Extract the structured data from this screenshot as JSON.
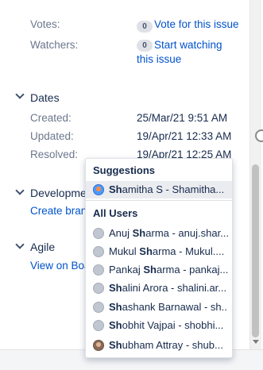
{
  "people": {
    "votes_label": "Votes:",
    "votes_count": "0",
    "votes_action": "Vote for this issue",
    "watchers_label": "Watchers:",
    "watchers_count": "0",
    "watchers_action_line1": "Start watching",
    "watchers_action_line2": "this issue"
  },
  "dates": {
    "heading": "Dates",
    "created_label": "Created:",
    "created_value": "25/Mar/21 9:51 AM",
    "updated_label": "Updated:",
    "updated_value": "19/Apr/21 12:33 AM",
    "resolved_label": "Resolved:",
    "resolved_value": "19/Apr/21 12:25 AM"
  },
  "development": {
    "heading": "Development",
    "link": "Create branch"
  },
  "agile": {
    "heading": "Agile",
    "link": "View on Board"
  },
  "suggestions": {
    "heading": "Suggestions",
    "items": [
      {
        "bold": "Sh",
        "rest": "amitha S - Shamitha...",
        "avatar": "badge"
      }
    ]
  },
  "all_users": {
    "heading": "All Users",
    "items": [
      {
        "pre": "Anuj ",
        "bold": "Sh",
        "rest": "arma - anuj.shar...",
        "avatar": "default"
      },
      {
        "pre": "Mukul ",
        "bold": "Sh",
        "rest": "arma - Mukul....",
        "avatar": "default"
      },
      {
        "pre": "Pankaj ",
        "bold": "Sh",
        "rest": "arma - pankaj....",
        "avatar": "default"
      },
      {
        "pre": "",
        "bold": "Sh",
        "rest": "alini Arora - shalini.ar...",
        "avatar": "default"
      },
      {
        "pre": "",
        "bold": "Sh",
        "rest": "ashank Barnawal - sh...",
        "avatar": "default"
      },
      {
        "pre": "",
        "bold": "Sh",
        "rest": "obhit Vajpai - shobhi...",
        "avatar": "default"
      },
      {
        "pre": "",
        "bold": "Sh",
        "rest": "ubham Attray - shub...",
        "avatar": "photo"
      }
    ]
  }
}
